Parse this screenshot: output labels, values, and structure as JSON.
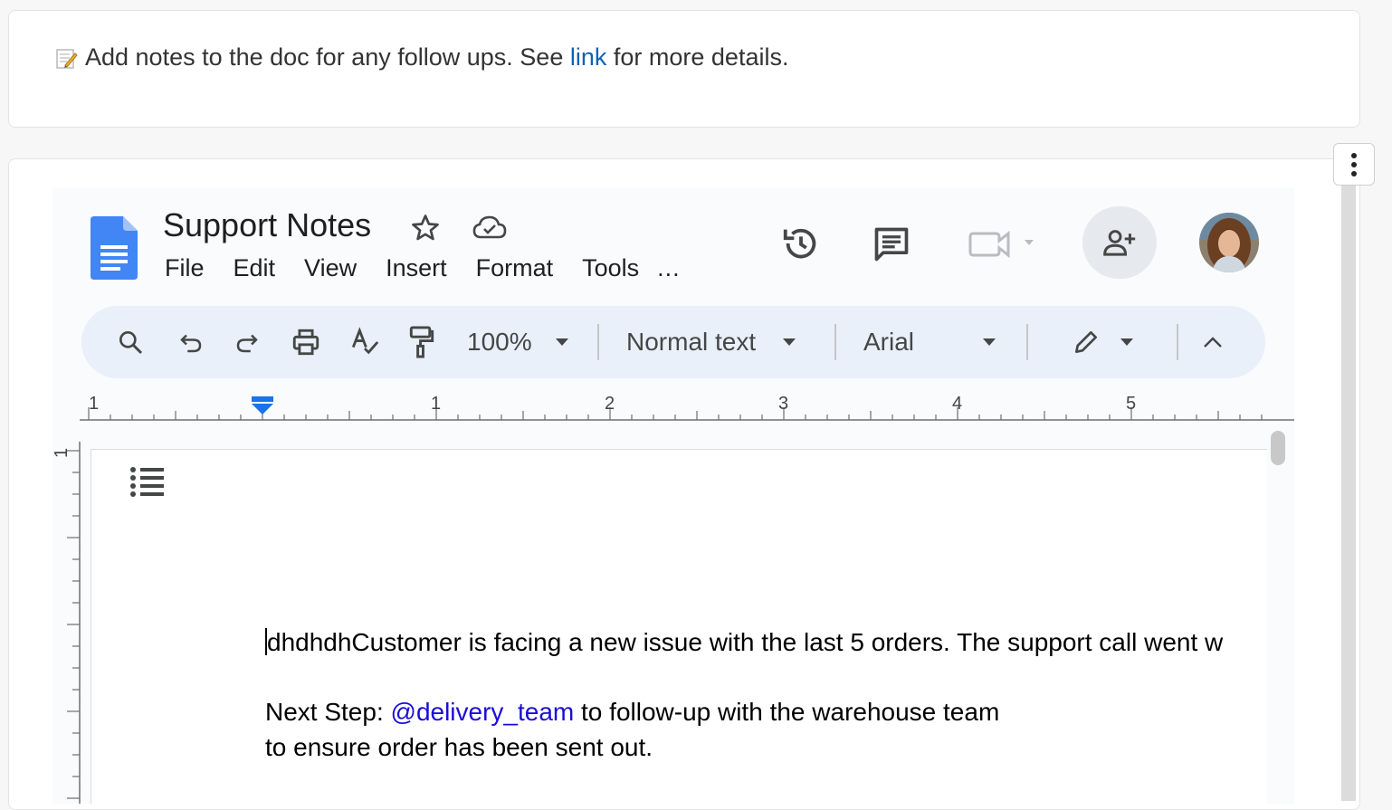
{
  "notice": {
    "icon": "memo-icon",
    "text_before": "Add notes to the doc for any follow ups. See ",
    "link_text": "link",
    "text_after": " for more details."
  },
  "doc": {
    "title": "Support Notes",
    "menu": [
      "File",
      "Edit",
      "View",
      "Insert",
      "Format",
      "Tools"
    ],
    "menu_more": "...",
    "toolbar": {
      "zoom": "100%",
      "style": "Normal text",
      "font": "Arial"
    },
    "ruler_labels": [
      "1",
      "1",
      "2",
      "3",
      "4",
      "5"
    ],
    "vruler_label": "1",
    "body": {
      "line1": "dhdhdhCustomer is facing a new issue with the last 5 orders. The support call went w",
      "line2_before": "Next Step: ",
      "line2_mention": "@delivery_team",
      "line2_after": " to follow-up with the warehouse team",
      "line3": "to ensure order has been sent out."
    }
  },
  "colors": {
    "link": "#0b63b6",
    "docs_blue": "#4285f4",
    "mention": "#1a0dd6",
    "toolbar_bg": "#eaf0f9"
  }
}
